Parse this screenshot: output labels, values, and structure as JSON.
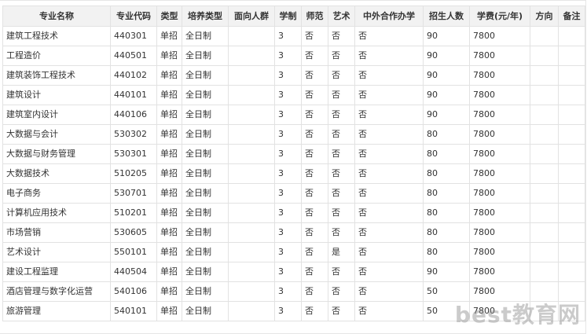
{
  "table": {
    "headers": [
      "专业名称",
      "专业代码",
      "类型",
      "培养类型",
      "面向人群",
      "学制",
      "师范",
      "艺术",
      "中外合作办学",
      "招生人数",
      "学费(元/年)",
      "方向",
      "备注"
    ],
    "rows": [
      [
        "建筑工程技术",
        "440301",
        "单招",
        "全日制",
        "",
        "3",
        "否",
        "否",
        "否",
        "90",
        "7800",
        "",
        ""
      ],
      [
        "工程造价",
        "440501",
        "单招",
        "全日制",
        "",
        "3",
        "否",
        "否",
        "否",
        "90",
        "7800",
        "",
        ""
      ],
      [
        "建筑装饰工程技术",
        "440102",
        "单招",
        "全日制",
        "",
        "3",
        "否",
        "否",
        "否",
        "90",
        "7800",
        "",
        ""
      ],
      [
        "建筑设计",
        "440101",
        "单招",
        "全日制",
        "",
        "3",
        "否",
        "否",
        "否",
        "90",
        "7800",
        "",
        ""
      ],
      [
        "建筑室内设计",
        "440106",
        "单招",
        "全日制",
        "",
        "3",
        "否",
        "否",
        "否",
        "90",
        "7800",
        "",
        ""
      ],
      [
        "大数据与会计",
        "530302",
        "单招",
        "全日制",
        "",
        "3",
        "否",
        "否",
        "否",
        "80",
        "7800",
        "",
        ""
      ],
      [
        "大数据与财务管理",
        "530301",
        "单招",
        "全日制",
        "",
        "3",
        "否",
        "否",
        "否",
        "80",
        "7800",
        "",
        ""
      ],
      [
        "大数据技术",
        "510205",
        "单招",
        "全日制",
        "",
        "3",
        "否",
        "否",
        "否",
        "80",
        "7800",
        "",
        ""
      ],
      [
        "电子商务",
        "530701",
        "单招",
        "全日制",
        "",
        "3",
        "否",
        "否",
        "否",
        "80",
        "7800",
        "",
        ""
      ],
      [
        "计算机应用技术",
        "510201",
        "单招",
        "全日制",
        "",
        "3",
        "否",
        "否",
        "否",
        "80",
        "7800",
        "",
        ""
      ],
      [
        "市场营销",
        "530605",
        "单招",
        "全日制",
        "",
        "3",
        "否",
        "否",
        "否",
        "80",
        "7800",
        "",
        ""
      ],
      [
        "艺术设计",
        "550101",
        "单招",
        "全日制",
        "",
        "3",
        "否",
        "是",
        "否",
        "80",
        "7800",
        "",
        ""
      ],
      [
        "建设工程监理",
        "440504",
        "单招",
        "全日制",
        "",
        "3",
        "否",
        "否",
        "否",
        "90",
        "7800",
        "",
        ""
      ],
      [
        "酒店管理与数字化运营",
        "540106",
        "单招",
        "全日制",
        "",
        "3",
        "否",
        "否",
        "否",
        "50",
        "7800",
        "",
        ""
      ],
      [
        "旅游管理",
        "540101",
        "单招",
        "全日制",
        "",
        "3",
        "否",
        "否",
        "否",
        "50",
        "7800",
        "",
        ""
      ]
    ]
  },
  "watermark": "best教育网"
}
